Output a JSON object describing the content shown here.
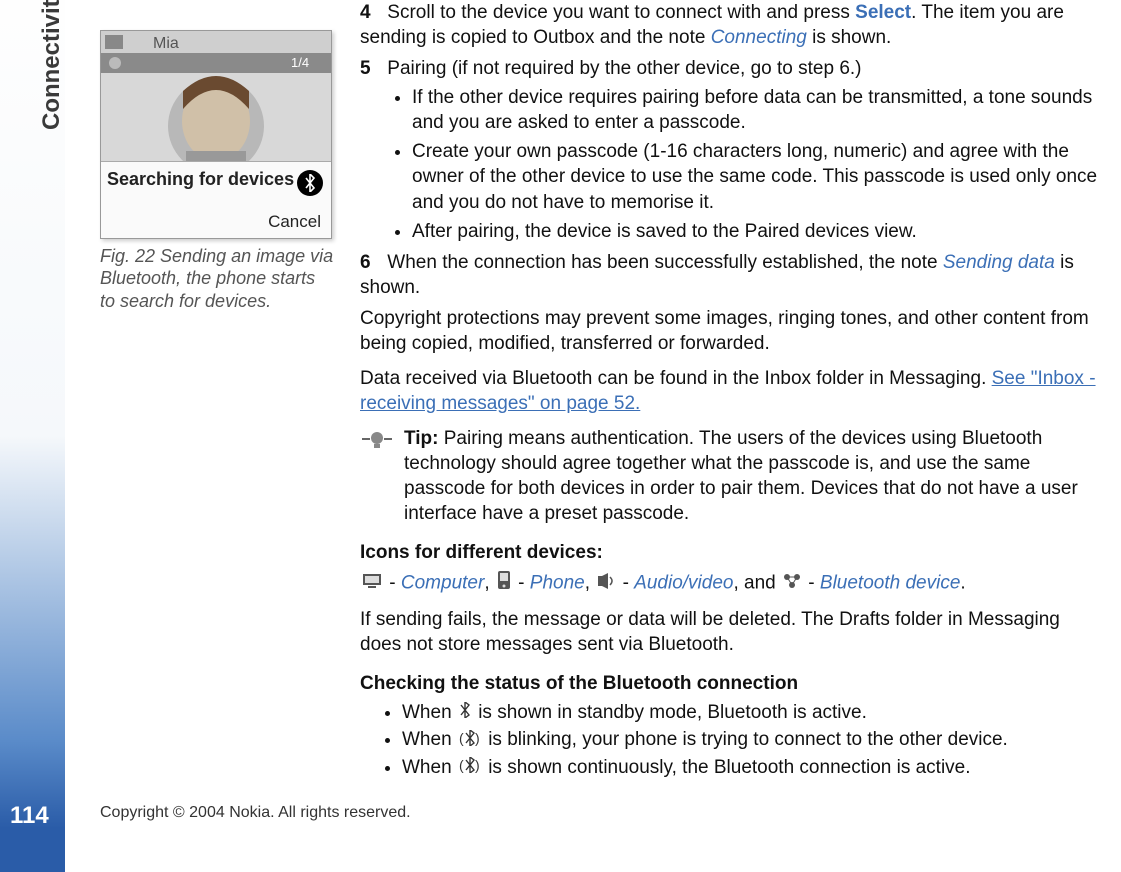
{
  "side_label": "Connectivity",
  "page_number": "114",
  "copyright": "Copyright © 2004 Nokia. All rights reserved.",
  "figure": {
    "top_name": "Mia",
    "counter": "1/4",
    "searching": "Searching for devices",
    "cancel": "Cancel",
    "caption": "Fig. 22 Sending an image via Bluetooth, the phone starts to search for devices."
  },
  "steps": {
    "s4": {
      "num": "4",
      "pre": "Scroll to the device you want to connect with and press ",
      "select": "Select",
      "mid": ". The item you are sending is copied to Outbox and the note ",
      "connecting": "Connecting",
      "post": " is shown."
    },
    "s5": {
      "num": "5",
      "text": "Pairing (if not required by the other device, go to step 6.)",
      "b1": "If the other device requires pairing before data can be transmitted, a tone sounds and you are asked to enter a passcode.",
      "b2": "Create your own passcode (1-16 characters long, numeric) and agree with the owner of the other device to use the same code. This passcode is used only once and you do not have to memorise it.",
      "b3": "After pairing, the device is saved to the Paired devices view."
    },
    "s6": {
      "num": "6",
      "pre": "When the connection has been successfully established, the note ",
      "sending": "Sending data",
      "post": " is shown."
    }
  },
  "para_copyright": "Copyright protections may prevent some images, ringing tones, and other content from being copied, modified, transferred or forwarded.",
  "para_inbox_pre": "Data received via Bluetooth can be found in the Inbox folder in Messaging. ",
  "para_inbox_link": "See \"Inbox - receiving messages\" on page 52.",
  "tip_label": "Tip:",
  "tip_text": " Pairing means authentication. The users of the devices using Bluetooth technology should agree together what the passcode is, and use the same passcode for both devices in order to pair them. Devices that do not have a user interface have a preset passcode.",
  "icons_header": "Icons for different devices:",
  "icons": {
    "dash": " - ",
    "computer": "Computer",
    "comma": ",  ",
    "phone": "Phone",
    "comma2": ", ",
    "av": "Audio/video",
    "and": ", and ",
    "bt": "Bluetooth device",
    "period": "."
  },
  "fail_text": "If sending fails, the message or data will be deleted. The Drafts folder in Messaging does not store messages sent via Bluetooth.",
  "status_header": "Checking the status of the Bluetooth connection",
  "status": {
    "b1a": "When ",
    "b1b": " is shown in standby mode, Bluetooth is active.",
    "b2a": "When ",
    "b2b": " is blinking, your phone is trying to connect to the other device.",
    "b3a": "When ",
    "b3b": " is shown continuously, the Bluetooth connection is active."
  }
}
